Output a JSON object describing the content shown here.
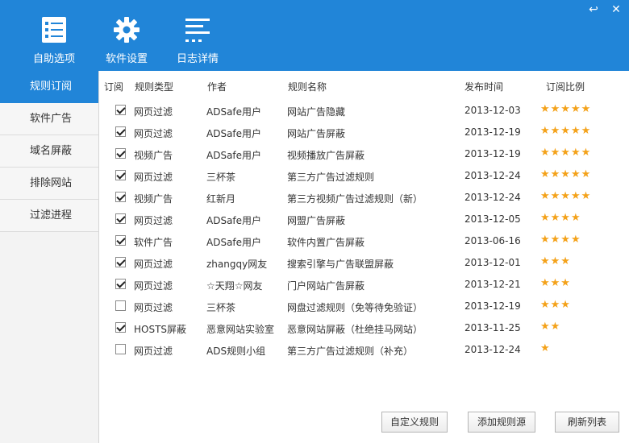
{
  "window": {
    "controls": [
      "↩",
      "✕"
    ]
  },
  "toolbar": [
    {
      "label": "自助选项",
      "icon": "checklist-icon"
    },
    {
      "label": "软件设置",
      "icon": "gear-icon"
    },
    {
      "label": "日志详情",
      "icon": "log-list-icon"
    }
  ],
  "sidebar": {
    "items": [
      {
        "label": "规则订阅",
        "active": true
      },
      {
        "label": "软件广告",
        "active": false
      },
      {
        "label": "域名屏蔽",
        "active": false
      },
      {
        "label": "排除网站",
        "active": false
      },
      {
        "label": "过滤进程",
        "active": false
      }
    ]
  },
  "table": {
    "headers": [
      "订阅",
      "规则类型",
      "作者",
      "规则名称",
      "发布时间",
      "订阅比例"
    ],
    "rows": [
      {
        "checked": true,
        "type": "网页过滤",
        "author": "ADSafe用户",
        "name": "网站广告隐藏",
        "date": "2013-12-03",
        "stars": "★★★★★"
      },
      {
        "checked": true,
        "type": "网页过滤",
        "author": "ADSafe用户",
        "name": "网站广告屏蔽",
        "date": "2013-12-19",
        "stars": "★★★★★"
      },
      {
        "checked": true,
        "type": "视频广告",
        "author": "ADSafe用户",
        "name": "视频播放广告屏蔽",
        "date": "2013-12-19",
        "stars": "★★★★★"
      },
      {
        "checked": true,
        "type": "网页过滤",
        "author": "三杯茶",
        "name": "第三方广告过滤规则",
        "date": "2013-12-24",
        "stars": "★★★★★"
      },
      {
        "checked": true,
        "type": "视频广告",
        "author": "红新月",
        "name": "第三方视频广告过滤规则（新）",
        "date": "2013-12-24",
        "stars": "★★★★★"
      },
      {
        "checked": true,
        "type": "网页过滤",
        "author": "ADSafe用户",
        "name": "网盟广告屏蔽",
        "date": "2013-12-05",
        "stars": "★★★★"
      },
      {
        "checked": true,
        "type": "软件广告",
        "author": "ADSafe用户",
        "name": "软件内置广告屏蔽",
        "date": "2013-06-16",
        "stars": "★★★★"
      },
      {
        "checked": true,
        "type": "网页过滤",
        "author": "zhangqy网友",
        "name": "搜索引擎与广告联盟屏蔽",
        "date": "2013-12-01",
        "stars": "★★★"
      },
      {
        "checked": true,
        "type": "网页过滤",
        "author": "☆天翔☆网友",
        "name": "门户网站广告屏蔽",
        "date": "2013-12-21",
        "stars": "★★★"
      },
      {
        "checked": false,
        "type": "网页过滤",
        "author": "三杯茶",
        "name": "网盘过滤规则（免等待免验证）",
        "date": "2013-12-19",
        "stars": "★★★"
      },
      {
        "checked": true,
        "type": "HOSTS屏蔽",
        "author": "恶意网站实验室",
        "name": "恶意网站屏蔽（杜绝挂马网站）",
        "date": "2013-11-25",
        "stars": "★★"
      },
      {
        "checked": false,
        "type": "网页过滤",
        "author": "ADS规则小组",
        "name": "第三方广告过滤规则（补充）",
        "date": "2013-12-24",
        "stars": "★"
      }
    ]
  },
  "buttons": {
    "custom_rules": "自定义规则",
    "add_source": "添加规则源",
    "refresh": "刷新列表"
  }
}
